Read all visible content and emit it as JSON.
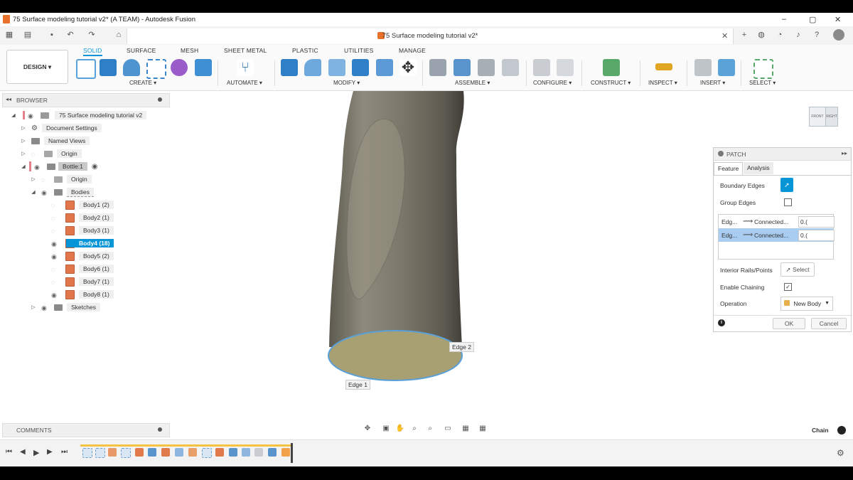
{
  "window": {
    "title": "75 Surface modeling tutorial v2* (A TEAM) - Autodesk Fusion",
    "doc_tab": "75 Surface modeling tutorial v2*",
    "controls": [
      "–",
      "▢",
      "✕"
    ]
  },
  "ribbon": {
    "design_label": "DESIGN ▾",
    "tabs": [
      "SOLID",
      "SURFACE",
      "MESH",
      "SHEET METAL",
      "PLASTIC",
      "UTILITIES",
      "MANAGE"
    ],
    "active_tab": "SOLID",
    "groups": [
      "CREATE ▾",
      "AUTOMATE ▾",
      "MODIFY ▾",
      "ASSEMBLE ▾",
      "CONFIGURE ▾",
      "CONSTRUCT ▾",
      "INSPECT ▾",
      "INSERT ▾",
      "SELECT ▾"
    ],
    "accent": "#0696d7"
  },
  "browser": {
    "title": "BROWSER",
    "root": "75 Surface modeling tutorial v2",
    "items": [
      {
        "label": "Document Settings"
      },
      {
        "label": "Named Views"
      },
      {
        "label": "Origin"
      },
      {
        "label": "Bottle:1"
      },
      {
        "label": "Origin"
      },
      {
        "label": "Bodies"
      },
      {
        "label": "Body1 (2)"
      },
      {
        "label": "Body2 (1)"
      },
      {
        "label": "Body3 (1)"
      },
      {
        "label": "Body4 (18)"
      },
      {
        "label": "Body5 (2)"
      },
      {
        "label": "Body6 (1)"
      },
      {
        "label": "Body7 (1)"
      },
      {
        "label": "Body8 (1)"
      },
      {
        "label": "Sketches"
      }
    ],
    "selected_body": "Body4 (18)"
  },
  "viewport": {
    "edge_labels": [
      "Edge 2",
      "Edge 1"
    ],
    "viewcube_labels": [
      "FRONT",
      "RIGHT"
    ],
    "body_color": "#8c8778",
    "face_color": "#b5aa7e"
  },
  "patch": {
    "title": "PATCH",
    "tabs": [
      "Feature",
      "Analysis"
    ],
    "active_tab": "Feature",
    "boundary_edges": "Boundary Edges",
    "group_edges": "Group Edges",
    "edges_table": [
      {
        "edge": "Edg...",
        "type": "Connected...",
        "value": "0.("
      },
      {
        "edge": "Edg...",
        "type": "Connected...",
        "value": "0.("
      }
    ],
    "interior_rails": "Interior Rails/Points",
    "select_label": "Select",
    "enable_chaining": "Enable Chaining",
    "operation": "Operation",
    "operation_value": "New Body",
    "ok": "OK",
    "cancel": "Cancel"
  },
  "comments": {
    "title": "COMMENTS"
  },
  "status": {
    "chain": "Chain"
  }
}
